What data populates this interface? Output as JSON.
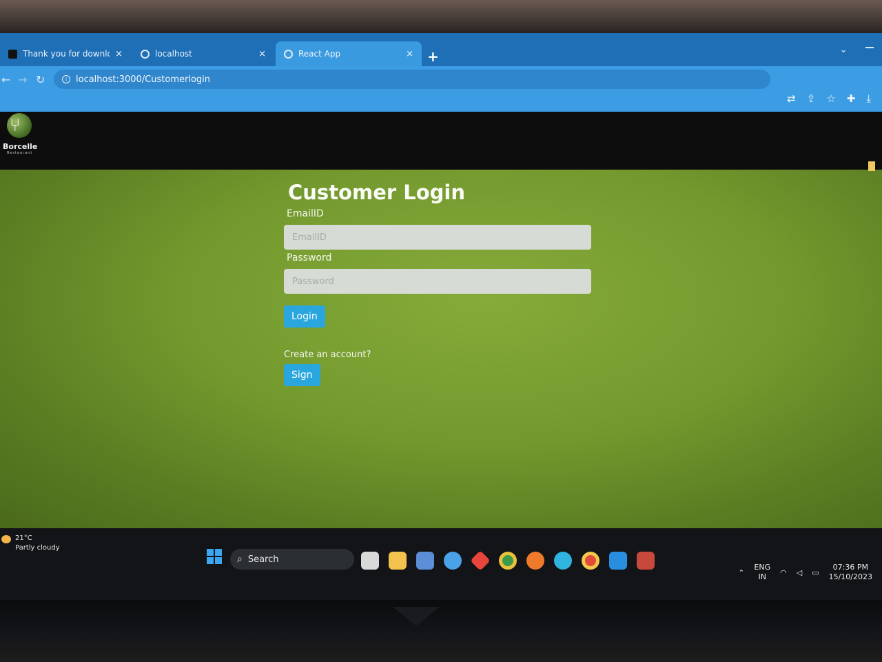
{
  "browser": {
    "tabs": [
      {
        "label": "Thank you for downloading Inte",
        "icon": "app-icon",
        "active": false
      },
      {
        "label": "localhost",
        "icon": "globe-icon",
        "active": false
      },
      {
        "label": "React App",
        "icon": "globe-icon",
        "active": true
      }
    ],
    "close_glyph": "×",
    "new_tab_glyph": "+",
    "url": "localhost:3000/Customerlogin"
  },
  "header": {
    "logo_name": "Borcelle",
    "logo_sub": "Restaurant"
  },
  "login": {
    "title": "Customer Login",
    "email_label": "EmailID",
    "email_placeholder": "EmailID",
    "email_value": "",
    "password_label": "Password",
    "password_placeholder": "Password",
    "password_value": "",
    "login_button": "Login",
    "create_prompt": "Create an account?",
    "signup_button": "Sign"
  },
  "taskbar": {
    "weather_temp": "21°C",
    "weather_desc": "Partly cloudy",
    "search_label": "Search",
    "lang_primary": "ENG",
    "lang_secondary": "IN",
    "time": "07:36 PM",
    "date": "15/10/2023"
  },
  "colors": {
    "accent_button": "#2aa6de",
    "page_background": "#73982d",
    "browser_tabbar": "#1f6fb7",
    "browser_toolbar": "#3d9de4"
  }
}
